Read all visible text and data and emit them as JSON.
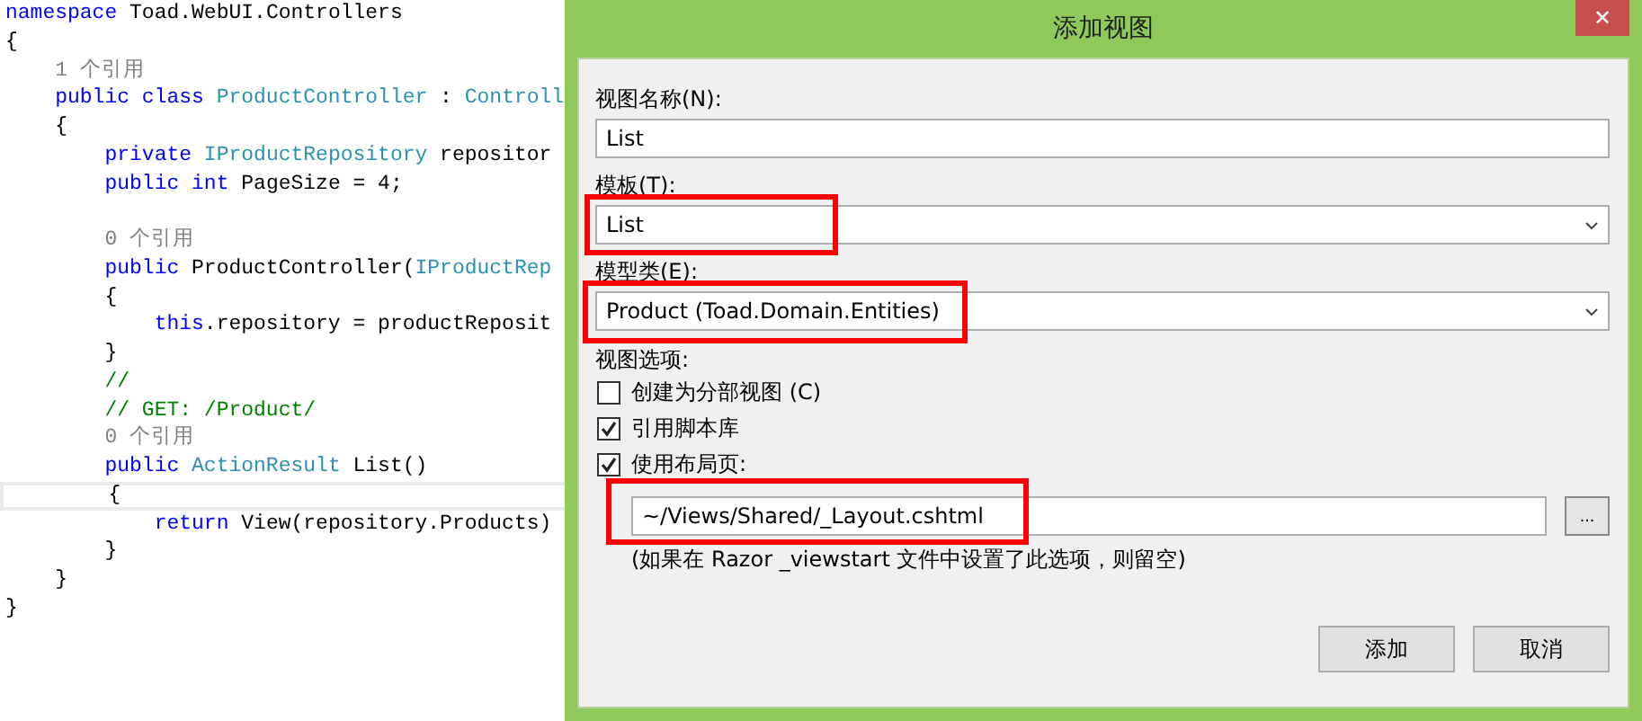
{
  "editor": {
    "lines": [
      {
        "current": false,
        "tokens": [
          {
            "kind": "keyword",
            "text": "namespace"
          },
          {
            "kind": "plain",
            "text": " Toad.WebUI.Controllers"
          }
        ]
      },
      {
        "current": false,
        "tokens": [
          {
            "kind": "plain",
            "text": "{"
          }
        ]
      },
      {
        "current": false,
        "tokens": [
          {
            "kind": "ref",
            "text": "    1 个引用"
          }
        ]
      },
      {
        "current": false,
        "tokens": [
          {
            "kind": "keyword",
            "text": "    public class"
          },
          {
            "kind": "type",
            "text": " ProductController"
          },
          {
            "kind": "plain",
            "text": " : "
          },
          {
            "kind": "type",
            "text": "Controll"
          }
        ]
      },
      {
        "current": false,
        "tokens": [
          {
            "kind": "plain",
            "text": "    {"
          }
        ]
      },
      {
        "current": false,
        "tokens": [
          {
            "kind": "keyword",
            "text": "        private"
          },
          {
            "kind": "type",
            "text": " IProductRepository"
          },
          {
            "kind": "plain",
            "text": " repositor"
          }
        ]
      },
      {
        "current": false,
        "tokens": [
          {
            "kind": "keyword",
            "text": "        public int"
          },
          {
            "kind": "plain",
            "text": " PageSize = 4;"
          }
        ]
      },
      {
        "current": false
      },
      {
        "current": false,
        "tokens": [
          {
            "kind": "ref",
            "text": "        0 个引用"
          }
        ]
      },
      {
        "current": false,
        "tokens": [
          {
            "kind": "keyword",
            "text": "        public"
          },
          {
            "kind": "plain",
            "text": " ProductController("
          },
          {
            "kind": "type",
            "text": "IProductRep"
          }
        ]
      },
      {
        "current": false,
        "tokens": [
          {
            "kind": "plain",
            "text": "        {"
          }
        ]
      },
      {
        "current": false,
        "tokens": [
          {
            "kind": "keyword",
            "text": "            this"
          },
          {
            "kind": "plain",
            "text": ".repository = productReposit"
          }
        ]
      },
      {
        "current": false,
        "tokens": [
          {
            "kind": "plain",
            "text": "        }"
          }
        ]
      },
      {
        "current": false,
        "tokens": [
          {
            "kind": "comment",
            "text": "        //"
          }
        ]
      },
      {
        "current": false,
        "tokens": [
          {
            "kind": "comment",
            "text": "        // GET: /Product/"
          }
        ]
      },
      {
        "current": false,
        "tokens": [
          {
            "kind": "ref",
            "text": "        0 个引用"
          }
        ]
      },
      {
        "current": false,
        "tokens": [
          {
            "kind": "keyword",
            "text": "        public"
          },
          {
            "kind": "type",
            "text": " ActionResult"
          },
          {
            "kind": "plain",
            "text": " List()"
          }
        ]
      },
      {
        "current": true,
        "tokens": [
          {
            "kind": "plain",
            "text": "        {"
          }
        ]
      },
      {
        "current": false,
        "tokens": [
          {
            "kind": "keyword",
            "text": "            return"
          },
          {
            "kind": "plain",
            "text": " View(repository.Products)"
          }
        ]
      },
      {
        "current": false,
        "tokens": [
          {
            "kind": "plain",
            "text": "        }"
          }
        ]
      },
      {
        "current": false,
        "tokens": [
          {
            "kind": "plain",
            "text": "    }"
          }
        ]
      },
      {
        "current": false,
        "tokens": [
          {
            "kind": "plain",
            "text": "}"
          }
        ]
      }
    ]
  },
  "dialog": {
    "title": "添加视图",
    "close": "✕",
    "view_name": {
      "label": "视图名称(N):",
      "value": "List"
    },
    "template": {
      "label": "模板(T):",
      "value": "List",
      "highlighted": true
    },
    "model_class": {
      "label": "模型类(E):",
      "value": "Product (Toad.Domain.Entities)",
      "highlighted": true
    },
    "options_label": "视图选项:",
    "options": [
      {
        "label": "创建为分部视图 (C)",
        "checked": false
      },
      {
        "label": "引用脚本库",
        "checked": true
      },
      {
        "label": "使用布局页:",
        "checked": true
      }
    ],
    "layout": {
      "value": "~/Views/Shared/_Layout.cshtml",
      "highlighted": true,
      "browse": "..."
    },
    "hint": "(如果在 Razor _viewstart 文件中设置了此选项，则留空)",
    "buttons": [
      "添加",
      "取消"
    ]
  }
}
